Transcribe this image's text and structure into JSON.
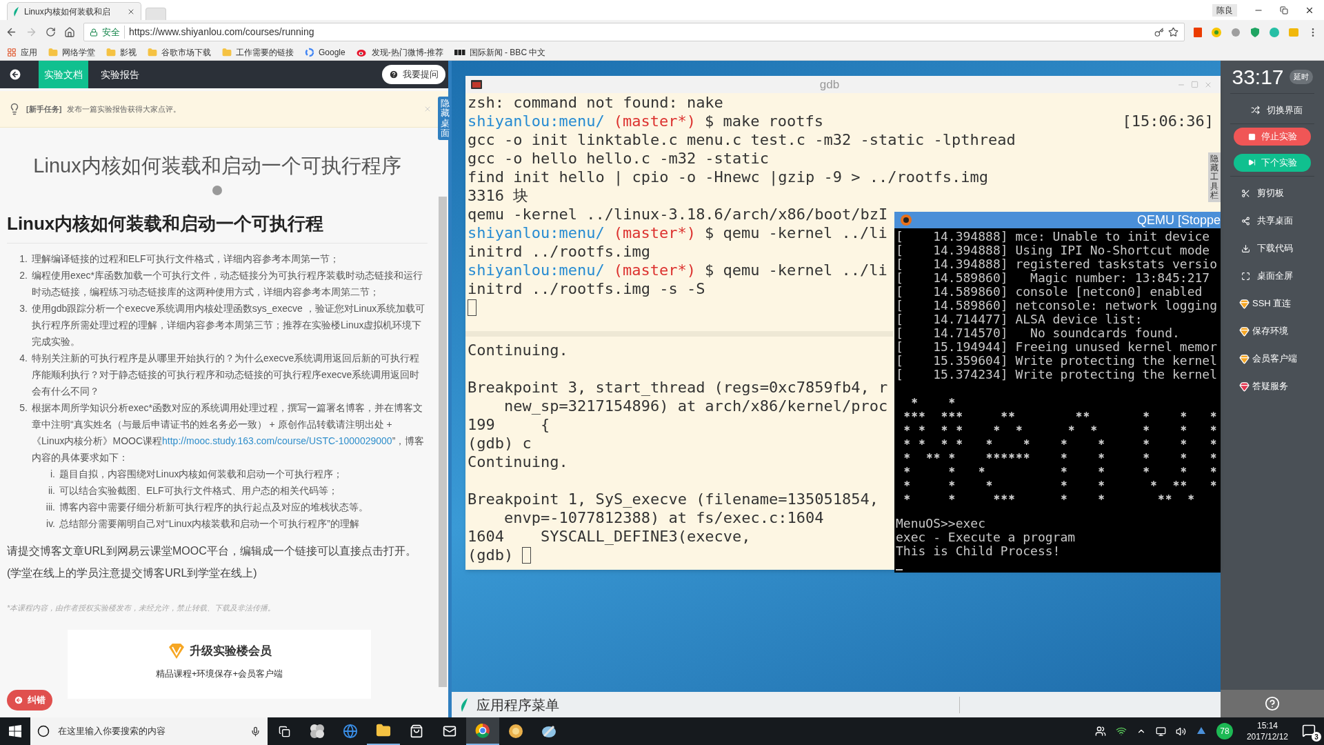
{
  "browser": {
    "tab": {
      "title": "Linux内核如何装载和启"
    },
    "user": "陈良",
    "address": {
      "security": "安全",
      "url": "https://www.shiyanlou.com/courses/running"
    },
    "bookmarks": [
      {
        "kind": "apps",
        "label": "应用"
      },
      {
        "kind": "folder",
        "label": "网络学堂"
      },
      {
        "kind": "folder",
        "label": "影视"
      },
      {
        "kind": "folder",
        "label": "谷歌市场下载"
      },
      {
        "kind": "folder",
        "label": "工作需要的链接"
      },
      {
        "kind": "ring",
        "label": "Google"
      },
      {
        "kind": "eye",
        "label": "发现-热门微博-推荐"
      },
      {
        "kind": "boxes",
        "label": "国际新闻 - BBC 中文"
      }
    ]
  },
  "lab_panel": {
    "tabs": [
      {
        "label": "实验文档",
        "selected": true
      },
      {
        "label": "实验报告",
        "selected": false
      }
    ],
    "ask_button": "我要提问",
    "notice": {
      "tag": "[新手任务]",
      "text": "发布一篇实验报告获得大家点评。"
    },
    "hide_desktop": "隐藏桌面",
    "title": "Linux内核如何装载和启动一个可执行程序",
    "heading": "Linux内核如何装载和启动一个可执行程",
    "steps": [
      {
        "number": "1.",
        "text": "理解编译链接的过程和ELF可执行文件格式，详细内容参考本周第一节；"
      },
      {
        "number": "2.",
        "text": "编程使用exec*库函数加载一个可执行文件，动态链接分为可执行程序装载时动态链接和运行时动态链接，编程练习动态链接库的这两种使用方式，详细内容参考本周第二节；"
      },
      {
        "number": "3.",
        "text": "使用gdb跟踪分析一个execve系统调用内核处理函数sys_execve ，验证您对Linux系统加载可执行程序所需处理过程的理解，详细内容参考本周第三节；推荐在实验楼Linux虚拟机环境下完成实验。"
      },
      {
        "number": "4.",
        "text": "特别关注新的可执行程序是从哪里开始执行的？为什么execve系统调用返回后新的可执行程序能顺利执行？对于静态链接的可执行程序和动态链接的可执行程序execve系统调用返回时会有什么不同？"
      },
      {
        "number": "5.",
        "text": "根据本周所学知识分析exec*函数对应的系统调用处理过程，撰写一篇署名博客，并在博客文章中注明“真实姓名（与最后申请证书的姓名务必一致） + 原创作品转载请注明出处 + 《Linux内核分析》MOOC课程",
        "link": "http://mooc.study.163.com/course/USTC-1000029000",
        "text_after": "”，博客内容的具体要求如下：",
        "children": [
          {
            "number": "i.",
            "text": "题目自拟，内容围绕对Linux内核如何装载和启动一个可执行程序；"
          },
          {
            "number": "ii.",
            "text": "可以结合实验截图、ELF可执行文件格式、用户态的相关代码等；"
          },
          {
            "number": "iii.",
            "text": "博客内容中需要仔细分析新可执行程序的执行起点及对应的堆栈状态等。"
          },
          {
            "number": "iv.",
            "text": "总结部分需要阐明自己对“Linux内核装载和启动一个可执行程序”的理解"
          }
        ]
      }
    ],
    "submit_note": "请提交博客文章URL到网易云课堂MOOC平台，编辑成一个链接可以直接点击打开。(学堂在线上的学员注意提交博客URL到学堂在线上)",
    "copyright": "*本课程内容，由作者授权实验楼发布，未经允许，禁止转载、下载及非法传播。",
    "member_card": {
      "title": "升级实验楼会员",
      "subtitle": "精品课程+环境保存+会员客户端"
    },
    "report_error_button": "纠错"
  },
  "desktop": {
    "gdb_window": {
      "title": "gdb",
      "hide_toolbar": "隐藏工具栏",
      "upper_lines": [
        {
          "kind": "text",
          "text": "zsh: command not found: nake"
        },
        {
          "kind": "prompt",
          "path": "shiyanlou:menu/",
          "branch": "(master*)",
          "command": "$ make rootfs",
          "time": "[15:06:36]"
        },
        {
          "kind": "text",
          "text": "gcc -o init linktable.c menu.c test.c -m32 -static -lpthread"
        },
        {
          "kind": "text",
          "text": "gcc -o hello hello.c -m32 -static"
        },
        {
          "kind": "text",
          "text": "find init hello | cpio -o -Hnewc |gzip -9 > ../rootfs.img"
        },
        {
          "kind": "text",
          "text": "3316 块"
        },
        {
          "kind": "text",
          "text": "qemu -kernel ../linux-3.18.6/arch/x86/boot/bzI"
        },
        {
          "kind": "prompt",
          "path": "shiyanlou:menu/",
          "branch": "(master*)",
          "command": "$ qemu -kernel ../li"
        },
        {
          "kind": "text",
          "text": "initrd ../rootfs.img"
        },
        {
          "kind": "prompt",
          "path": "shiyanlou:menu/",
          "branch": "(master*)",
          "command": "$ qemu -kernel ../li"
        },
        {
          "kind": "text",
          "text": "initrd ../rootfs.img -s -S"
        },
        {
          "kind": "cursor"
        }
      ],
      "lower_lines": [
        {
          "kind": "text",
          "text": "Continuing.",
          "gap_before": false
        },
        {
          "kind": "text",
          "text": "Breakpoint 3, start_thread (regs=0xc7859fb4, r",
          "gap_before": true
        },
        {
          "kind": "text",
          "text": "    new_sp=3217154896) at arch/x86/kernel/proc",
          "gap_before": false
        },
        {
          "kind": "text",
          "text": "199     {",
          "gap_before": false
        },
        {
          "kind": "text",
          "text": "(gdb) c",
          "gap_before": false
        },
        {
          "kind": "text",
          "text": "Continuing.",
          "gap_before": false
        },
        {
          "kind": "text",
          "text": "Breakpoint 1, SyS_execve (filename=135051854,",
          "gap_before": true
        },
        {
          "kind": "text",
          "text": "    envp=-1077812388) at fs/exec.c:1604",
          "gap_before": false
        },
        {
          "kind": "text",
          "text": "1604    SYSCALL_DEFINE3(execve,",
          "gap_before": false
        },
        {
          "kind": "input",
          "text": "(gdb)",
          "gap_before": false
        }
      ]
    },
    "qemu_window": {
      "title": "QEMU [Stoppe",
      "log_lines": [
        "[    14.394888] mce: Unable to init device",
        "[    14.394888] Using IPI No-Shortcut mode",
        "[    14.394888] registered taskstats versio",
        "[    14.589860]   Magic number: 13:845:217",
        "[    14.589860] console [netcon0] enabled",
        "[    14.589860] netconsole: network logging",
        "[    14.714477] ALSA device list:",
        "[    14.714570]   No soundcards found.",
        "[    15.194944] Freeing unused kernel memor",
        "[    15.359604] Write protecting the kernel",
        "[    15.374234] Write protecting the kernel"
      ],
      "console_lines": [
        "MenuOS>>exec",
        "exec - Execute a program",
        "This is Child Process!"
      ]
    },
    "app_menu": "应用程序菜单"
  },
  "lab_sidebar": {
    "timer": "33:17",
    "extend_button": "延时",
    "items": [
      {
        "kind": "plain",
        "label": "切换界面"
      },
      {
        "kind": "stop",
        "label": "停止实验"
      },
      {
        "kind": "next",
        "label": "下个实验"
      },
      {
        "kind": "plain",
        "label": "剪切板"
      },
      {
        "kind": "plain",
        "label": "共享桌面"
      },
      {
        "kind": "plain",
        "label": "下载代码"
      },
      {
        "kind": "plain",
        "label": "桌面全屏"
      },
      {
        "kind": "premium",
        "label": "SSH 直连"
      },
      {
        "kind": "premium",
        "label": "保存环境"
      },
      {
        "kind": "premium",
        "label": "会员客户端"
      },
      {
        "kind": "support",
        "label": "答疑服务"
      }
    ]
  },
  "taskbar": {
    "search": {
      "placeholder": "在这里输入你要搜索的内容"
    },
    "badge": "78",
    "time": "15:14",
    "date": "2017/12/12",
    "notifications": "3"
  }
}
